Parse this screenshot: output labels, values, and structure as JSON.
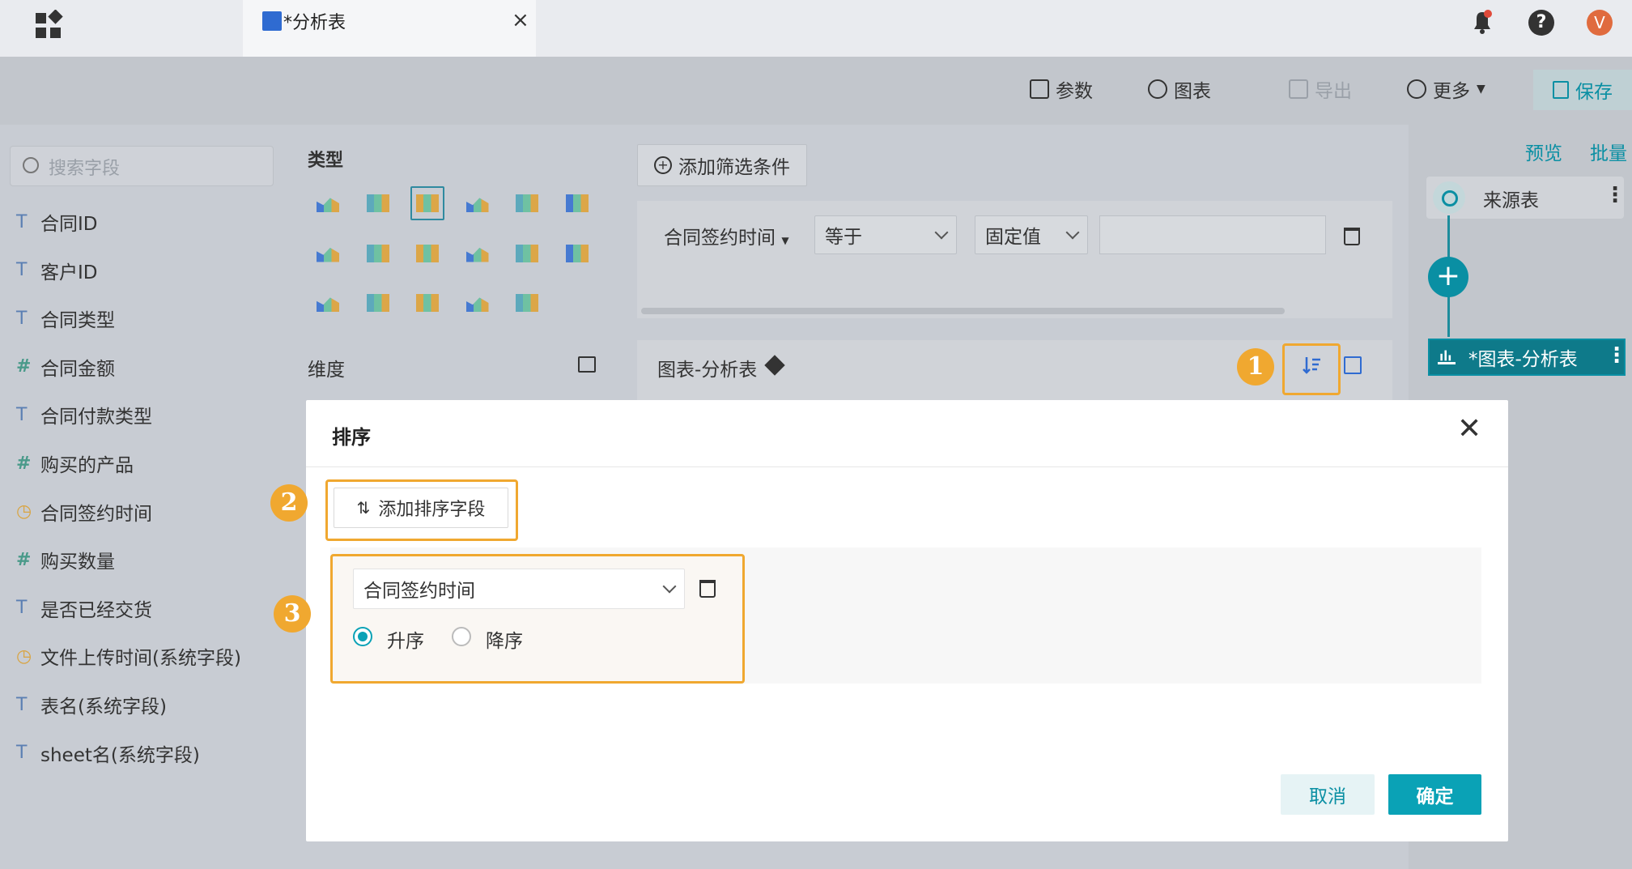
{
  "tab": {
    "label": "*分析表",
    "close": "×"
  },
  "user": {
    "avatar_letter": "V",
    "help": "?"
  },
  "toolbar": {
    "params": "参数",
    "chart": "图表",
    "export": "导出",
    "more": "更多",
    "save": "保存"
  },
  "search": {
    "placeholder": "搜索字段"
  },
  "fields": [
    {
      "label": "合同ID",
      "type": "text"
    },
    {
      "label": "客户ID",
      "type": "text"
    },
    {
      "label": "合同类型",
      "type": "text"
    },
    {
      "label": "合同金额",
      "type": "number"
    },
    {
      "label": "合同付款类型",
      "type": "text"
    },
    {
      "label": "购买的产品",
      "type": "number"
    },
    {
      "label": "合同签约时间",
      "type": "time"
    },
    {
      "label": "购买数量",
      "type": "number"
    },
    {
      "label": "是否已经交货",
      "type": "text"
    },
    {
      "label": "文件上传时间(系统字段)",
      "type": "time"
    },
    {
      "label": "表名(系统字段)",
      "type": "text"
    },
    {
      "label": "sheet名(系统字段)",
      "type": "text"
    }
  ],
  "field_icons": {
    "text": "T",
    "number": "#",
    "time": "◷"
  },
  "types_panel": {
    "title": "类型",
    "dimension_label": "维度"
  },
  "filter": {
    "add_label": "添加筛选条件",
    "field": "合同签约时间",
    "operator": "等于",
    "value_type": "固定值",
    "value": ""
  },
  "chart_panel": {
    "title": "图表-分析表"
  },
  "flow": {
    "preview": "预览",
    "batch": "批量",
    "source_label": "来源表",
    "chart_node_label": "*图表-分析表",
    "add": "+"
  },
  "callouts": {
    "one": "1",
    "two": "2",
    "three": "3"
  },
  "dialog": {
    "title": "排序",
    "close": "✕",
    "add_sort_label": "添加排序字段",
    "sort_field": "合同签约时间",
    "asc_label": "升序",
    "desc_label": "降序",
    "order": "asc",
    "cancel_label": "取消",
    "ok_label": "确定"
  },
  "colors": {
    "accent": "#0aa2b6",
    "callout": "#f0a830",
    "brand_blue": "#2f6bd1"
  }
}
